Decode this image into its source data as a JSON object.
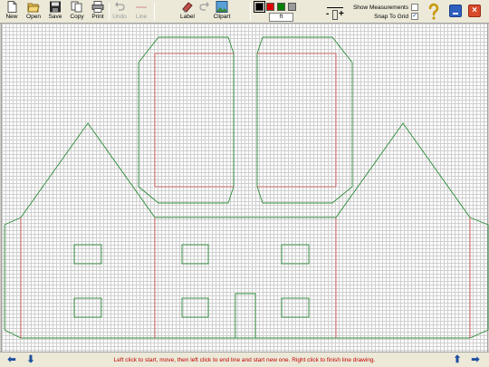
{
  "toolbar": {
    "new_label": "New",
    "open_label": "Open",
    "save_label": "Save",
    "copy_label": "Copy",
    "print_label": "Print",
    "undo_label": "Undo",
    "line_label": "Line",
    "label_label": "Label",
    "clipart_label": "Clipart",
    "unit_value": "ft",
    "colors": [
      "#000000",
      "#e00000",
      "#008000",
      "#9b9b9b"
    ],
    "selected_color": "#000000",
    "show_measurements_label": "Show Measurements",
    "show_measurements_checked": false,
    "snap_to_grid_label": "Snap To Grid",
    "snap_to_grid_checked": true
  },
  "status": {
    "message": "Left click to start, move, then left click to end line and start new one. Right click to finish line drawing."
  },
  "drawing_colors": {
    "outline": "#2e8b3a",
    "fold": "#d24a4a"
  },
  "icons": {
    "new": "new-document-icon",
    "open": "open-folder-icon",
    "save": "floppy-disk-icon",
    "copy": "copy-icon",
    "print": "printer-icon",
    "undo": "undo-arrow-icon",
    "line": "line-tool-icon",
    "label": "label-eraser-icon",
    "clipart": "clipart-picture-icon",
    "help": "question-mark-icon",
    "nav_left": "arrow-left-icon",
    "nav_down": "arrow-down-icon",
    "nav_up": "arrow-up-icon",
    "nav_right": "arrow-right-icon"
  }
}
